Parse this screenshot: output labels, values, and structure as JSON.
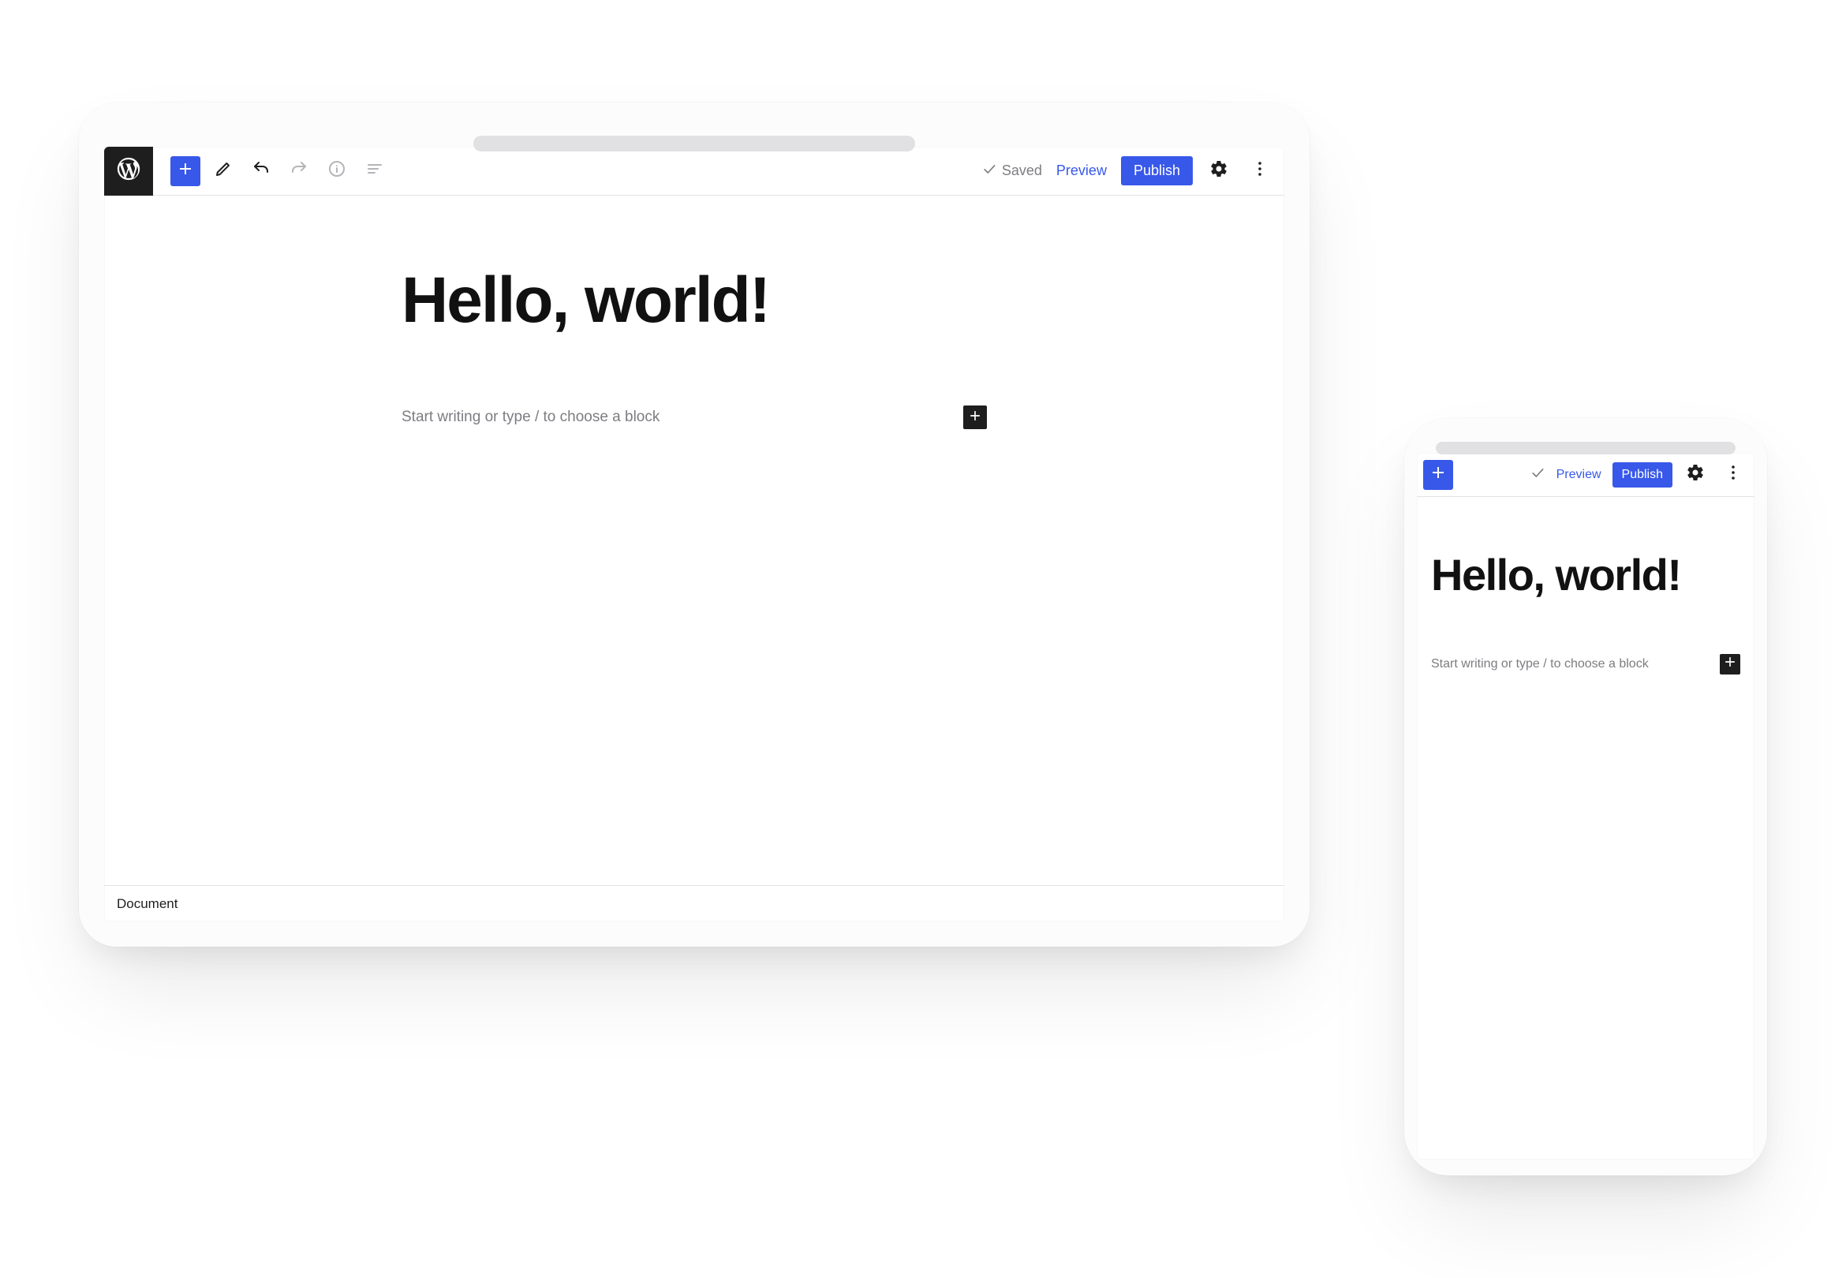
{
  "tablet": {
    "toolbar": {
      "saved_label": "Saved",
      "preview_label": "Preview",
      "publish_label": "Publish"
    },
    "post": {
      "title": "Hello, world!",
      "block_placeholder": "Start writing or type / to choose a block"
    },
    "footer": {
      "breadcrumb": "Document"
    }
  },
  "phone": {
    "toolbar": {
      "preview_label": "Preview",
      "publish_label": "Publish"
    },
    "post": {
      "title": "Hello, world!",
      "block_placeholder": "Start writing or type / to choose a block"
    }
  },
  "colors": {
    "accent": "#3858E9",
    "text": "#1e1e1e",
    "muted": "#7d7d82"
  }
}
